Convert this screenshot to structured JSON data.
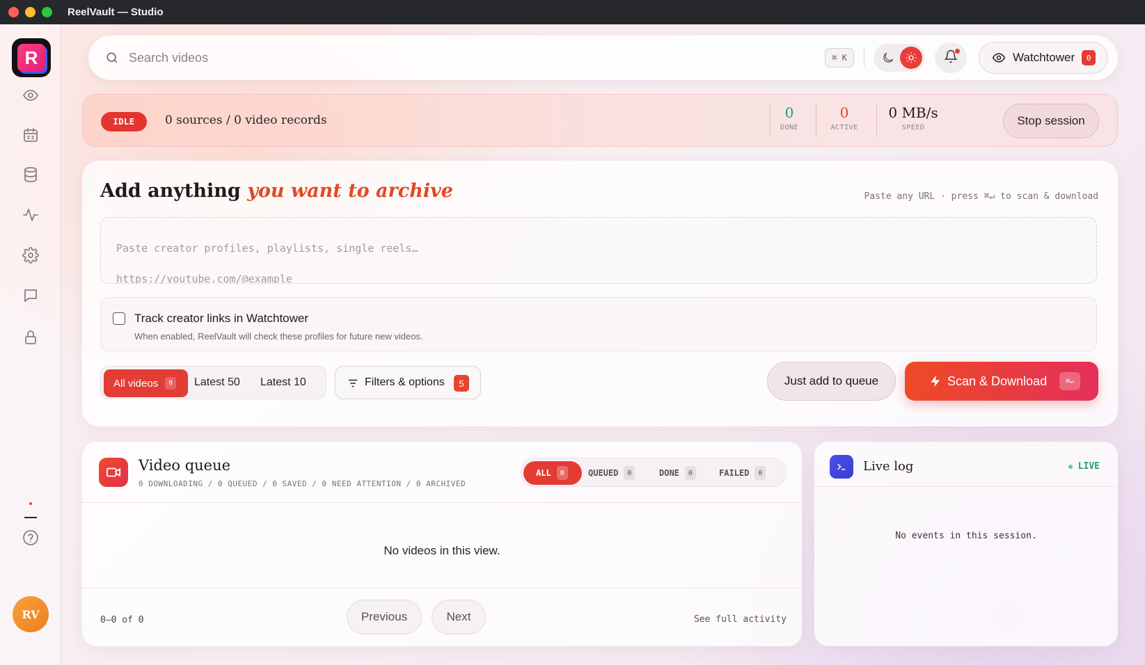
{
  "window": {
    "title": "ReelVault — Studio"
  },
  "brand": {
    "logo_letter": "R",
    "accent": "#e23c35"
  },
  "sidebar": {
    "items": [
      {
        "name": "watch",
        "icon": "eye-icon"
      },
      {
        "name": "schedule",
        "icon": "calendar-icon"
      },
      {
        "name": "library",
        "icon": "database-icon"
      },
      {
        "name": "activity",
        "icon": "activity-icon"
      },
      {
        "name": "settings",
        "icon": "gear-icon"
      },
      {
        "name": "messages",
        "icon": "chat-icon"
      },
      {
        "name": "vault",
        "icon": "lock-icon"
      }
    ],
    "help_icon": "help-icon",
    "avatar_initials": "RV"
  },
  "search": {
    "placeholder": "Search videos",
    "shortcut": "⌘ K"
  },
  "header": {
    "watchtower_label": "Watchtower",
    "watchtower_count": "0"
  },
  "status": {
    "state": "IDLE",
    "summary": "0 sources / 0 video records",
    "stats": [
      {
        "value": "0",
        "label": "DONE",
        "color": "#23a36a"
      },
      {
        "value": "0",
        "label": "ACTIVE",
        "color": "#e04a24"
      },
      {
        "value": "0 MB/s",
        "label": "SPEED",
        "color": "#1f1a1c"
      }
    ],
    "stop_label": "Stop session"
  },
  "add": {
    "title_plain": "Add anything",
    "title_accent": "you want to archive",
    "hint": "Paste any URL · press ⌘↵ to scan & download",
    "textarea_placeholder": "Paste creator profiles, playlists, single reels…\nhttps://youtube.com/@example",
    "track_title": "Track creator links in Watchtower",
    "track_desc": "When enabled, ReelVault will check these profiles for future new videos.",
    "segments": {
      "all_label": "All videos",
      "all_count": "0",
      "latest50": "Latest 50",
      "latest10": "Latest 10"
    },
    "filters_label": "Filters & options",
    "filters_count": "5",
    "queue_label": "Just add to queue",
    "scan_label": "Scan & Download",
    "scan_shortcut": "⌘↵"
  },
  "queue": {
    "title": "Video queue",
    "subtitle": "0 DOWNLOADING / 0 QUEUED / 0 SAVED / 0 NEED ATTENTION / 0 ARCHIVED",
    "tabs": [
      {
        "label": "ALL",
        "count": "0"
      },
      {
        "label": "QUEUED",
        "count": "0"
      },
      {
        "label": "DONE",
        "count": "0"
      },
      {
        "label": "FAILED",
        "count": "0"
      }
    ],
    "empty": "No videos in this view.",
    "range": "0–0 of 0",
    "prev": "Previous",
    "next": "Next",
    "full_activity": "See full activity"
  },
  "log": {
    "title": "Live log",
    "live": "LIVE",
    "empty": "No events in this session."
  }
}
